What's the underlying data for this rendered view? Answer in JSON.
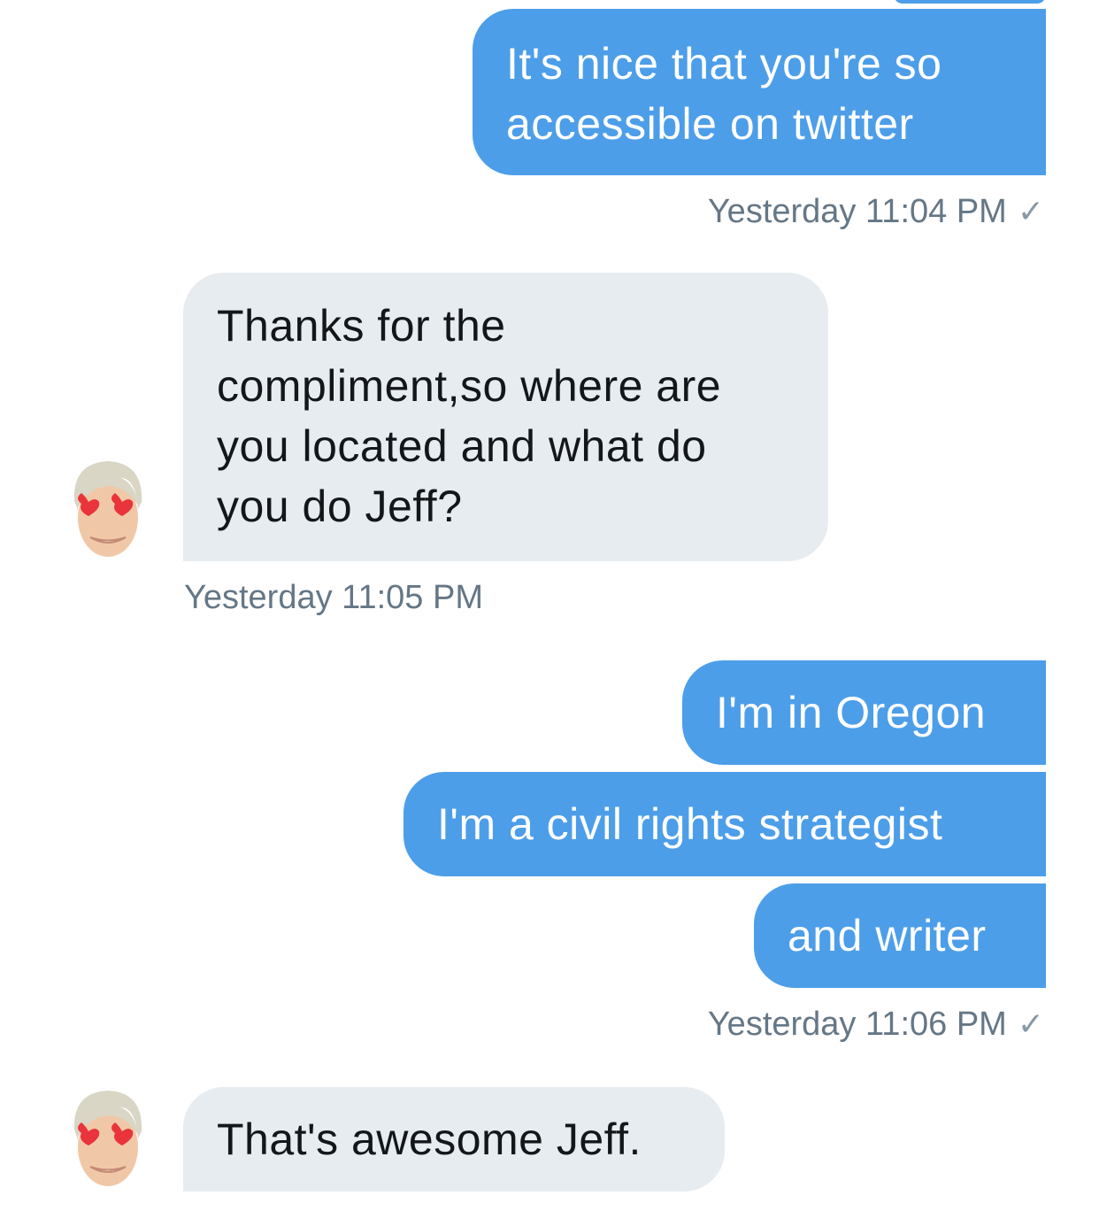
{
  "messages": [
    {
      "sender": "me",
      "text_lines": [
        "It's nice that you're so",
        "accessible on twitter"
      ]
    },
    {
      "sender": "them",
      "text_lines": [
        "Thanks for the",
        "compliment,so where are",
        "you located and what do",
        "you do Jeff?"
      ]
    },
    {
      "sender": "me",
      "text": "I'm in Oregon"
    },
    {
      "sender": "me",
      "text": "I'm a civil rights strategist"
    },
    {
      "sender": "me",
      "text": "and writer"
    },
    {
      "sender": "them",
      "text": "That's awesome Jeff."
    }
  ],
  "timestamps": {
    "t1": "Yesterday 11:04 PM",
    "t2": "Yesterday 11:05 PM",
    "t3": "Yesterday 11:06 PM"
  },
  "read_receipt_icon": "✓",
  "avatar_icon": "memoji-heart-eyes-icon",
  "colors": {
    "outgoing_bubble": "#4d9ee9",
    "incoming_bubble": "#e6ecf0",
    "timestamp": "#657786"
  }
}
